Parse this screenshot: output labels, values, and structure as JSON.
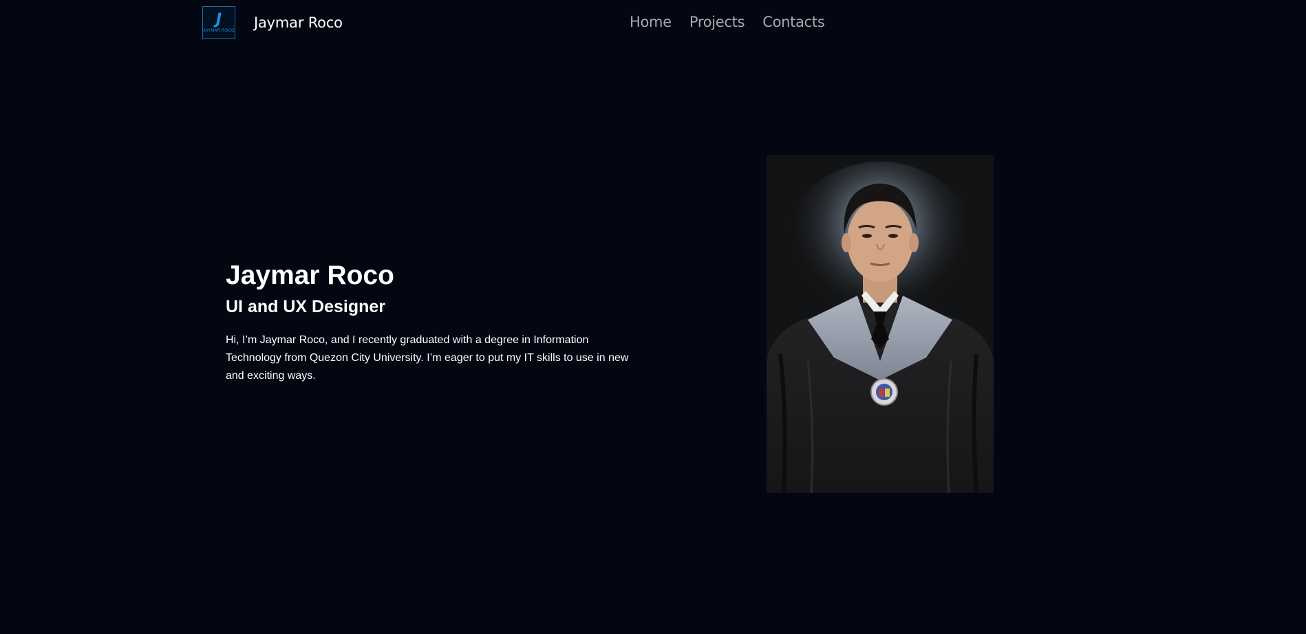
{
  "header": {
    "logo_text": "JAYMAR ROCO",
    "logo_mark": "J",
    "brand_name": "Jaymar Roco",
    "nav": [
      {
        "label": "Home"
      },
      {
        "label": "Projects"
      },
      {
        "label": "Contacts"
      }
    ]
  },
  "hero": {
    "name": "Jaymar Roco",
    "role": "UI and UX Designer",
    "description": "Hi, I’m Jaymar Roco, and I recently graduated with a degree in Information Technology from Quezon City University. I’m eager to put my IT skills to use in new and exciting ways."
  },
  "colors": {
    "background": "#020712",
    "accent": "#1f8fe0",
    "nav_text": "#a7a9ae",
    "text": "#ffffff"
  }
}
